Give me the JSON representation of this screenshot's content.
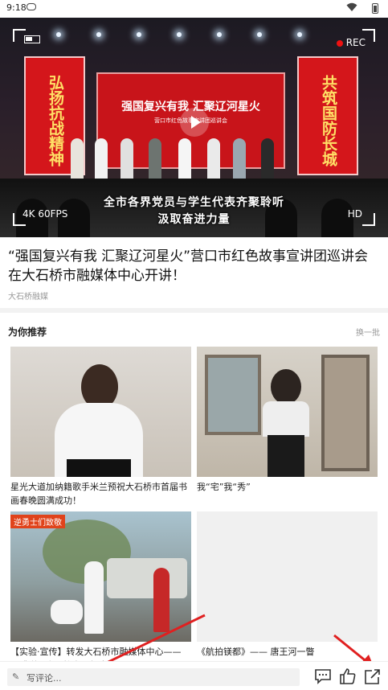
{
  "status_bar": {
    "time": "9:18",
    "icons": [
      "game-controller-icon",
      "wifi-icon",
      "battery-icon"
    ]
  },
  "video": {
    "rec_label": "REC",
    "fps_label": "4K 60FPS",
    "hd_label": "HD",
    "subtitle_line1": "全市各界党员与学生代表齐聚聆听",
    "subtitle_line2": "汲取奋进力量",
    "banner_left": "弘扬抗战精神",
    "banner_right": "共筑国防长城",
    "banner_main": "强国复兴有我  汇聚辽河星火",
    "banner_sub": "营口市红色故事宣讲团巡讲会",
    "rec_color": "#e11111"
  },
  "article": {
    "title": "“强国复兴有我  汇聚辽河星火”营口市红色故事宣讲团巡讲会在大石桥市融媒体中心开讲！",
    "source": "大石桥融媒"
  },
  "recommend": {
    "section_title": "为你推荐",
    "refresh_label": "换一批",
    "items": [
      {
        "caption": "星光大道加纳籍歌手米兰预祝大石桥市首届书画春晚圆满成功！"
      },
      {
        "caption": "我“宅”我“秀”"
      },
      {
        "caption": "【实验·宣传】转发大石桥市融媒体中心——《感谢！齐心协力，打赢疫",
        "tag": "逆勇士们致敬"
      },
      {
        "caption": "《航拍镁都》—— 唐王河一瞥"
      }
    ]
  },
  "bottom_bar": {
    "comment_placeholder": "写评论...",
    "icons": [
      "comment-icon",
      "like-icon",
      "share-icon"
    ]
  },
  "colors": {
    "accent_red": "#d4161b",
    "annotation_arrow": "#e02020"
  }
}
